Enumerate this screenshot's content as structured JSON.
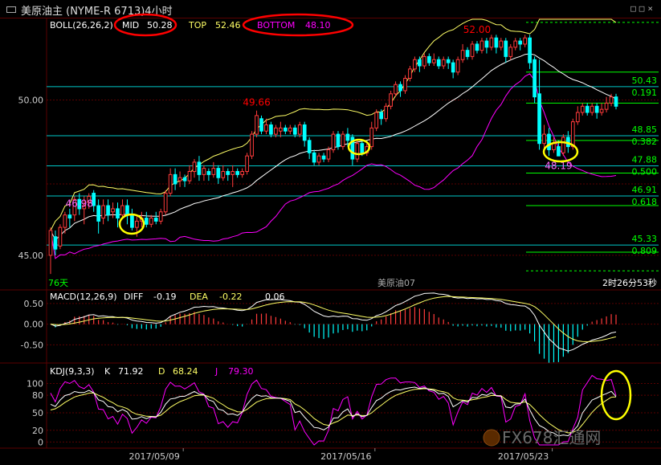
{
  "window": {
    "title": "美原油主 (NYME-R 6713)4小时",
    "buttons": [
      "□",
      "□",
      "×"
    ]
  },
  "colors": {
    "background": "#000000",
    "up": "#ff3b3b",
    "down": "#00ffff",
    "mid": "#ffffff",
    "top": "#ffff66",
    "bottom": "#ff00ff",
    "grid": "#5a0000",
    "annotation": "#ff0000",
    "circle": "#ffff00",
    "fib_line": "#00c8c8",
    "fib_green": "#00ff00"
  },
  "chart_data": [
    {
      "type": "candlestick",
      "title": "",
      "indicator_label": "BOLL(26,26,2)",
      "indicator_values": [
        {
          "name": "MID",
          "value": "50.28"
        },
        {
          "name": "TOP",
          "value": "52.46"
        },
        {
          "name": "BOTTOM",
          "value": "48.10"
        }
      ],
      "y_ticks": [
        "50.00",
        "45.00"
      ],
      "ylim": [
        44.3,
        52.6
      ],
      "candles": [
        [
          45.0,
          45.8,
          44.4,
          45.9
        ],
        [
          45.6,
          45.2,
          45.0,
          45.8
        ],
        [
          45.3,
          45.9,
          45.2,
          46.0
        ],
        [
          45.9,
          46.3,
          45.7,
          46.4
        ],
        [
          46.3,
          46.2,
          45.9,
          46.5
        ],
        [
          46.3,
          46.8,
          46.1,
          46.9
        ],
        [
          46.8,
          46.5,
          46.3,
          47.0
        ],
        [
          46.5,
          46.6,
          46.0,
          46.9
        ],
        [
          46.7,
          46.9,
          46.5,
          47.0
        ],
        [
          47.0,
          46.6,
          46.4,
          47.1
        ],
        [
          46.6,
          46.1,
          45.7,
          46.8
        ],
        [
          46.2,
          46.6,
          46.0,
          46.8
        ],
        [
          46.6,
          46.3,
          46.1,
          46.8
        ],
        [
          46.4,
          46.5,
          46.2,
          46.7
        ],
        [
          46.5,
          46.2,
          45.9,
          46.7
        ],
        [
          46.3,
          46.6,
          46.2,
          46.8
        ],
        [
          46.6,
          46.3,
          46.0,
          46.8
        ],
        [
          46.3,
          45.9,
          45.8,
          46.5
        ],
        [
          45.9,
          46.1,
          45.6,
          46.3
        ],
        [
          46.1,
          46.2,
          45.9,
          46.4
        ],
        [
          46.2,
          46.0,
          45.9,
          46.4
        ],
        [
          46.0,
          46.2,
          45.9,
          46.3
        ],
        [
          46.2,
          46.1,
          46.0,
          46.4
        ],
        [
          46.1,
          46.4,
          46.0,
          46.5
        ],
        [
          46.4,
          47.0,
          46.3,
          47.1
        ],
        [
          47.0,
          47.6,
          46.9,
          47.8
        ],
        [
          47.6,
          47.3,
          47.1,
          47.8
        ],
        [
          47.4,
          47.5,
          47.2,
          47.7
        ],
        [
          47.5,
          47.4,
          47.2,
          47.6
        ],
        [
          47.4,
          47.7,
          47.3,
          47.9
        ],
        [
          47.7,
          48.0,
          47.5,
          48.1
        ],
        [
          48.0,
          47.6,
          47.4,
          48.2
        ],
        [
          47.6,
          47.8,
          47.4,
          47.9
        ],
        [
          47.7,
          47.6,
          47.4,
          47.8
        ],
        [
          47.6,
          47.8,
          47.5,
          48.0
        ],
        [
          47.8,
          47.5,
          47.3,
          47.9
        ],
        [
          47.5,
          47.7,
          47.4,
          47.9
        ],
        [
          47.7,
          47.6,
          47.4,
          47.8
        ],
        [
          47.6,
          47.7,
          47.2,
          47.9
        ],
        [
          47.7,
          47.6,
          47.5,
          47.8
        ],
        [
          47.6,
          47.7,
          47.5,
          47.8
        ],
        [
          47.7,
          48.2,
          47.6,
          48.3
        ],
        [
          48.2,
          48.9,
          48.1,
          49.0
        ],
        [
          48.9,
          49.5,
          48.8,
          49.66
        ],
        [
          49.4,
          49.0,
          48.9,
          49.5
        ],
        [
          49.0,
          49.2,
          48.9,
          49.4
        ],
        [
          49.2,
          48.9,
          48.8,
          49.3
        ],
        [
          48.9,
          49.1,
          48.8,
          49.2
        ],
        [
          49.0,
          49.1,
          48.8,
          49.3
        ],
        [
          49.1,
          49.0,
          48.9,
          49.2
        ],
        [
          49.0,
          49.1,
          48.9,
          49.2
        ],
        [
          49.1,
          48.9,
          48.8,
          49.2
        ],
        [
          48.9,
          49.2,
          48.8,
          49.3
        ],
        [
          49.2,
          48.7,
          48.5,
          49.3
        ],
        [
          48.7,
          48.3,
          48.1,
          48.8
        ],
        [
          48.3,
          48.0,
          47.9,
          48.4
        ],
        [
          48.0,
          48.2,
          47.9,
          48.3
        ],
        [
          48.2,
          48.1,
          48.0,
          48.3
        ],
        [
          48.1,
          48.4,
          48.0,
          48.5
        ],
        [
          48.4,
          48.9,
          48.3,
          49.0
        ],
        [
          48.9,
          48.5,
          48.4,
          49.0
        ],
        [
          48.5,
          48.9,
          48.4,
          49.0
        ],
        [
          48.9,
          48.7,
          48.5,
          49.1
        ],
        [
          48.8,
          48.1,
          47.9,
          48.9
        ],
        [
          48.1,
          48.6,
          48.0,
          48.7
        ],
        [
          48.6,
          48.3,
          48.2,
          48.7
        ],
        [
          48.3,
          48.5,
          48.2,
          48.6
        ],
        [
          48.5,
          49.1,
          48.4,
          49.3
        ],
        [
          49.1,
          49.6,
          49.0,
          49.7
        ],
        [
          49.6,
          49.4,
          49.2,
          49.7
        ],
        [
          49.4,
          49.8,
          49.3,
          49.9
        ],
        [
          49.8,
          50.2,
          49.7,
          50.3
        ],
        [
          50.2,
          50.5,
          50.1,
          50.6
        ],
        [
          50.5,
          50.3,
          50.1,
          50.6
        ],
        [
          50.3,
          50.7,
          50.2,
          50.8
        ],
        [
          50.7,
          51.0,
          50.6,
          51.1
        ],
        [
          51.0,
          51.3,
          50.9,
          51.4
        ],
        [
          51.3,
          51.1,
          50.9,
          51.4
        ],
        [
          51.1,
          51.4,
          51.0,
          51.5
        ],
        [
          51.4,
          51.2,
          51.1,
          51.5
        ],
        [
          51.2,
          51.3,
          51.1,
          51.5
        ],
        [
          51.3,
          51.1,
          51.0,
          51.4
        ],
        [
          51.1,
          51.3,
          51.0,
          51.4
        ],
        [
          51.3,
          51.2,
          51.0,
          51.4
        ],
        [
          51.2,
          50.9,
          50.7,
          51.3
        ],
        [
          50.9,
          51.3,
          50.8,
          51.4
        ],
        [
          51.3,
          51.6,
          51.2,
          51.8
        ],
        [
          51.6,
          51.4,
          51.3,
          51.7
        ],
        [
          51.4,
          51.8,
          51.3,
          51.9
        ],
        [
          51.8,
          51.6,
          51.5,
          51.9
        ],
        [
          51.6,
          51.9,
          51.5,
          52.0
        ],
        [
          51.9,
          51.7,
          51.5,
          52.0
        ],
        [
          51.7,
          52.0,
          51.6,
          52.1
        ],
        [
          52.0,
          51.7,
          51.5,
          52.1
        ],
        [
          51.7,
          51.9,
          51.6,
          52.0
        ],
        [
          51.9,
          51.4,
          51.2,
          52.0
        ],
        [
          51.4,
          51.7,
          51.3,
          51.8
        ],
        [
          51.7,
          51.9,
          51.6,
          52.0
        ],
        [
          51.9,
          51.8,
          51.6,
          52.0
        ],
        [
          51.8,
          52.0,
          51.7,
          52.1
        ],
        [
          52.0,
          51.2,
          51.0,
          52.1
        ],
        [
          51.3,
          50.1,
          49.9,
          51.4
        ],
        [
          50.2,
          48.6,
          48.4,
          51.3
        ],
        [
          48.6,
          48.9,
          48.3,
          49.2
        ],
        [
          48.9,
          48.4,
          48.2,
          49.1
        ],
        [
          48.4,
          48.6,
          48.3,
          48.8
        ],
        [
          48.5,
          48.2,
          48.19,
          48.7
        ],
        [
          48.3,
          48.8,
          48.2,
          48.9
        ],
        [
          48.8,
          48.5,
          48.3,
          49.0
        ],
        [
          48.5,
          49.3,
          48.4,
          49.4
        ],
        [
          49.3,
          49.6,
          49.2,
          49.8
        ],
        [
          49.6,
          49.8,
          49.5,
          49.9
        ],
        [
          49.8,
          49.6,
          49.5,
          49.9
        ],
        [
          49.6,
          49.8,
          49.5,
          49.9
        ],
        [
          49.8,
          49.6,
          49.4,
          49.9
        ],
        [
          49.6,
          49.7,
          49.5,
          49.9
        ],
        [
          49.7,
          49.9,
          49.6,
          50.1
        ],
        [
          49.9,
          50.1,
          49.8,
          50.2
        ],
        [
          50.1,
          49.8,
          49.7,
          50.2
        ]
      ],
      "annotations": [
        {
          "text": "46.98",
          "x_index": 6,
          "value": 46.98
        },
        {
          "text": "49.66",
          "x_index": 43,
          "value": 49.66
        },
        {
          "text": "52.00",
          "x_index": 89,
          "value": 52.0
        },
        {
          "text": "48.19",
          "x_index": 106,
          "value": 48.19
        }
      ],
      "fibonacci": [
        {
          "price": "50.43",
          "ratio": "0.191"
        },
        {
          "price": "48.85",
          "ratio": "0.382"
        },
        {
          "price": "47.88",
          "ratio": "0.500"
        },
        {
          "price": "46.91",
          "ratio": "0.618"
        },
        {
          "price": "45.33",
          "ratio": "0.809"
        }
      ],
      "footer_left": "76天",
      "footer_center": "美原油07",
      "footer_right": "2时26分53秒"
    },
    {
      "type": "bar",
      "title": "",
      "indicator_label": "MACD(12,26,9)",
      "indicator_values": [
        {
          "name": "DIFF",
          "value": "-0.19"
        },
        {
          "name": "DEA",
          "value": "-0.22"
        },
        {
          "name": "",
          "value": "0.06"
        }
      ],
      "y_ticks": [
        "0.50",
        "0.00",
        "-0.50"
      ]
    },
    {
      "type": "line",
      "title": "",
      "indicator_label": "KDJ(9,3,3)",
      "indicator_values": [
        {
          "name": "K",
          "value": "71.92"
        },
        {
          "name": "D",
          "value": "68.24"
        },
        {
          "name": "J",
          "value": "79.30"
        }
      ],
      "y_ticks": [
        "100",
        "80",
        "50",
        "20",
        "0"
      ]
    }
  ],
  "x_axis_dates": [
    "2017/05/09",
    "2017/05/16",
    "2017/05/23"
  ],
  "watermark": "FX678汇通网"
}
